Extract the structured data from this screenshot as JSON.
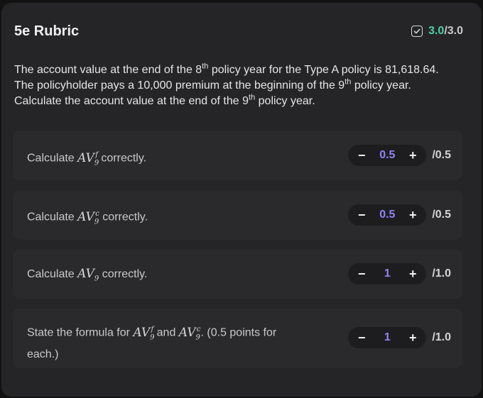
{
  "header": {
    "title": "5e Rubric",
    "score_earned": "3.0",
    "score_total": "/3.0"
  },
  "prompt": {
    "p1": "The account value at the end of the 8",
    "sup1": "th",
    "p2": " policy year for the Type A policy is 81,618.64. The policyholder pays a 10,000 premium at the beginning of the 9",
    "sup2": "th",
    "p3": " policy year. Calculate the account value at the end of the 9",
    "sup3": "th",
    "p4": " policy year."
  },
  "rubric_items": [
    {
      "pre": "Calculate ",
      "math_base": "AV",
      "math_sub": "9",
      "math_sup": "f",
      "post": " correctly.",
      "minus": "−",
      "plus": "+",
      "value": "0.5",
      "max": "/0.5"
    },
    {
      "pre": "Calculate ",
      "math_base": "AV",
      "math_sub": "9",
      "math_sup": "c",
      "post": " correctly.",
      "minus": "−",
      "plus": "+",
      "value": "0.5",
      "max": "/0.5"
    },
    {
      "pre": "Calculate ",
      "math_base": "AV",
      "math_sub": "9",
      "post": " correctly.",
      "minus": "−",
      "plus": "+",
      "value": "1",
      "max": "/1.0"
    },
    {
      "pre": "State the formula for ",
      "math1_base": "AV",
      "math1_sub": "9",
      "math1_sup": "f",
      "mid": " and ",
      "math2_base": "AV",
      "math2_sub": "9",
      "math2_sup": "c",
      "post": ". (0.5 points for each.)",
      "minus": "−",
      "plus": "+",
      "value": "1",
      "max": "/1.0"
    }
  ],
  "colors": {
    "accent_score": "#4fd1a5",
    "stepper_value": "#8f85f5"
  },
  "icons": {
    "score": "checkbox-checked-icon"
  }
}
